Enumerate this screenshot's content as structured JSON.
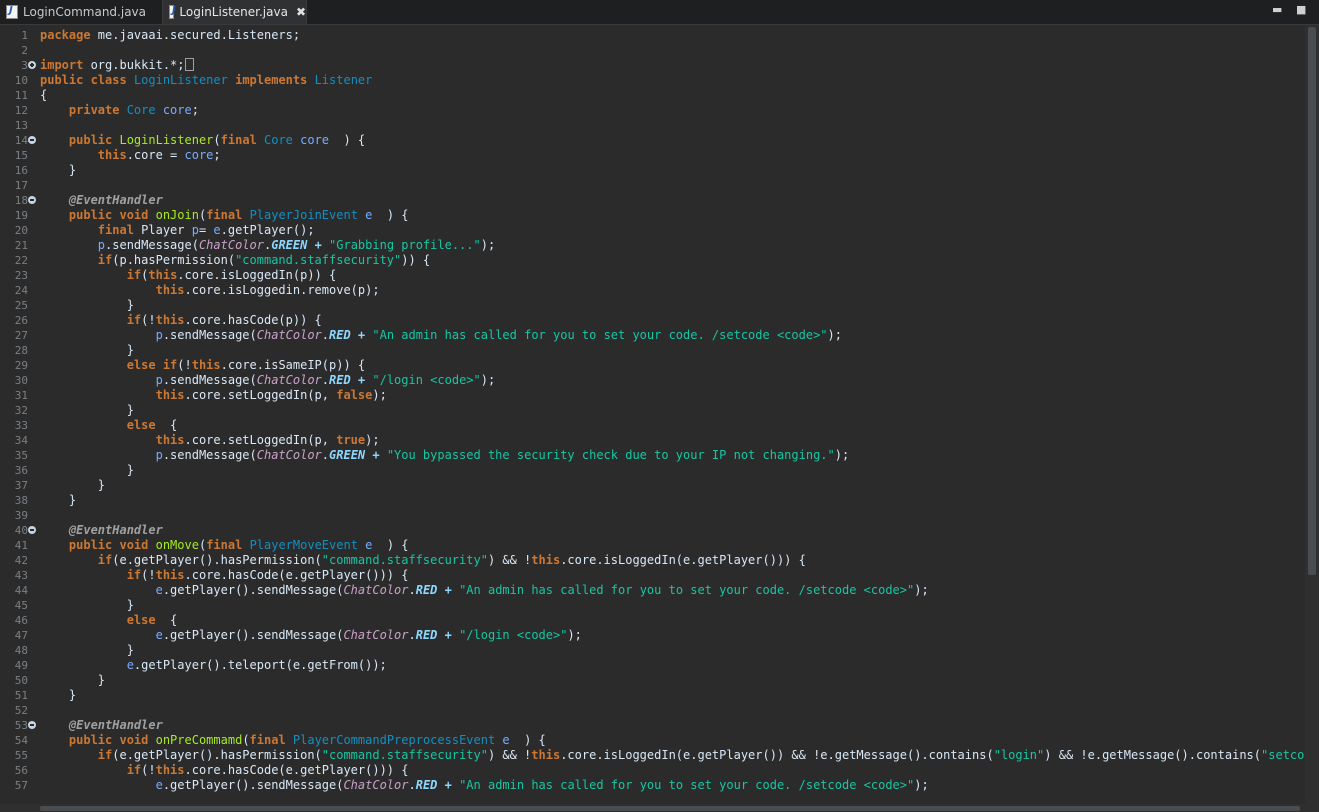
{
  "tabs": [
    {
      "label": "LoginCommand.java",
      "active": false
    },
    {
      "label": "LoginListener.java",
      "active": true
    }
  ],
  "window": {
    "close_tab_glyph": "✖",
    "minimize_glyph": "▬",
    "maximize_glyph": "■"
  },
  "editor": {
    "lines": [
      {
        "n": "1",
        "fold": "",
        "t": [
          [
            "kw",
            "package"
          ],
          [
            "",
            "me.javaai.secured.Listeners;"
          ]
        ]
      },
      {
        "n": "2",
        "fold": "",
        "t": []
      },
      {
        "n": "3",
        "fold": "plus",
        "t": [
          [
            "kw",
            "import"
          ],
          [
            "",
            "org.bukkit.*;"
          ]
        ]
      },
      {
        "n": "10",
        "fold": "",
        "t": [
          [
            "kw",
            "public"
          ],
          [
            "kw",
            "class"
          ],
          [
            "ty",
            "LoginListener"
          ],
          [
            "kw",
            "implements"
          ],
          [
            "ty",
            "Listener"
          ]
        ]
      },
      {
        "n": "11",
        "fold": "",
        "t": [
          [
            "",
            "{"
          ]
        ]
      },
      {
        "n": "12",
        "fold": "",
        "t": [
          [
            "kw",
            "    private"
          ],
          [
            "ty",
            "Core"
          ],
          [
            "va",
            "core"
          ],
          [
            "",
            ";"
          ]
        ]
      },
      {
        "n": "13",
        "fold": "",
        "t": []
      },
      {
        "n": "14",
        "fold": "minus",
        "t": [
          [
            "kw",
            "    public"
          ],
          [
            "fn",
            "LoginListener"
          ],
          [
            "",
            "("
          ],
          [
            "kw",
            "final"
          ],
          [
            "ty",
            "Core"
          ],
          [
            "va",
            "core"
          ],
          [
            "",
            " ) {"
          ]
        ]
      },
      {
        "n": "15",
        "fold": "",
        "t": [
          [
            "kw",
            "        this"
          ],
          [
            "",
            ".core = "
          ],
          [
            "va",
            "core"
          ],
          [
            "",
            ";"
          ]
        ]
      },
      {
        "n": "16",
        "fold": "",
        "t": [
          [
            "",
            "    }"
          ]
        ]
      },
      {
        "n": "17",
        "fold": "",
        "t": []
      },
      {
        "n": "18",
        "fold": "minus",
        "t": [
          [
            "an",
            "    @EventHandler"
          ]
        ]
      },
      {
        "n": "19",
        "fold": "",
        "t": [
          [
            "kw",
            "    public"
          ],
          [
            "kw",
            "void"
          ],
          [
            "fn",
            "onJoin"
          ],
          [
            "",
            "("
          ],
          [
            "kw",
            "final"
          ],
          [
            "ty",
            "PlayerJoinEvent"
          ],
          [
            "va",
            "e"
          ],
          [
            "",
            " ) {"
          ]
        ]
      },
      {
        "n": "20",
        "fold": "",
        "t": [
          [
            "kw",
            "        final"
          ],
          [
            "",
            "Player "
          ],
          [
            "va",
            "p"
          ],
          [
            "",
            "= "
          ],
          [
            "va",
            "e"
          ],
          [
            "",
            ".getPlayer();"
          ]
        ]
      },
      {
        "n": "21",
        "fold": "",
        "t": [
          [
            "va",
            "        p"
          ],
          [
            "",
            ".sendMessage("
          ],
          [
            "cc",
            "ChatColor"
          ],
          [
            "",
            "."
          ],
          [
            "cn",
            "GREEN"
          ],
          [
            "",
            ""
          ],
          [
            "st",
            "\"Grabbing profile...\""
          ],
          [
            "",
            ");"
          ]
        ]
      },
      {
        "n": "22",
        "fold": "",
        "t": [
          [
            "kw",
            "        if"
          ],
          [
            "",
            "(p.hasPermission("
          ],
          [
            "st",
            "\"command.staffsecurity\""
          ],
          [
            "",
            ")) {"
          ]
        ]
      },
      {
        "n": "23",
        "fold": "",
        "t": [
          [
            "kw",
            "            if"
          ],
          [
            "",
            "("
          ],
          [
            "kw",
            "this"
          ],
          [
            "",
            ".core.isLoggedIn(p)) {"
          ]
        ]
      },
      {
        "n": "24",
        "fold": "",
        "t": [
          [
            "kw",
            "                this"
          ],
          [
            "",
            ".core.isLoggedin.remove(p);"
          ]
        ]
      },
      {
        "n": "25",
        "fold": "",
        "t": [
          [
            "",
            "            }"
          ]
        ]
      },
      {
        "n": "26",
        "fold": "",
        "t": [
          [
            "kw",
            "            if"
          ],
          [
            "",
            "(!"
          ],
          [
            "kw",
            "this"
          ],
          [
            "",
            ".core.hasCode(p)) {"
          ]
        ]
      },
      {
        "n": "27",
        "fold": "",
        "t": [
          [
            "va",
            "                p"
          ],
          [
            "",
            ".sendMessage("
          ],
          [
            "cc",
            "ChatColor"
          ],
          [
            "",
            "."
          ],
          [
            "cn",
            "RED"
          ],
          [
            "",
            ""
          ],
          [
            "st",
            "\"An admin has called for you to set your code. /setcode <code>\""
          ],
          [
            "",
            ");"
          ]
        ]
      },
      {
        "n": "28",
        "fold": "",
        "t": [
          [
            "",
            "            }"
          ]
        ]
      },
      {
        "n": "29",
        "fold": "",
        "t": [
          [
            "kw",
            "            else if"
          ],
          [
            "",
            "(!"
          ],
          [
            "kw",
            "this"
          ],
          [
            "",
            ".core.isSameIP(p)) {"
          ]
        ]
      },
      {
        "n": "30",
        "fold": "",
        "t": [
          [
            "va",
            "                p"
          ],
          [
            "",
            ".sendMessage("
          ],
          [
            "cc",
            "ChatColor"
          ],
          [
            "",
            "."
          ],
          [
            "cn",
            "RED"
          ],
          [
            "",
            ""
          ],
          [
            "st",
            "\"/login <code>\""
          ],
          [
            "",
            ");"
          ]
        ]
      },
      {
        "n": "31",
        "fold": "",
        "t": [
          [
            "kw",
            "                this"
          ],
          [
            "",
            ".core.setLoggedIn(p, "
          ],
          [
            "kw",
            "false"
          ],
          [
            "",
            ");"
          ]
        ]
      },
      {
        "n": "32",
        "fold": "",
        "t": [
          [
            "",
            "            }"
          ]
        ]
      },
      {
        "n": "33",
        "fold": "",
        "t": [
          [
            "kw",
            "            else"
          ],
          [
            "",
            " {"
          ]
        ]
      },
      {
        "n": "34",
        "fold": "",
        "t": [
          [
            "kw",
            "                this"
          ],
          [
            "",
            ".core.setLoggedIn(p, "
          ],
          [
            "kw",
            "true"
          ],
          [
            "",
            ");"
          ]
        ]
      },
      {
        "n": "35",
        "fold": "",
        "t": [
          [
            "va",
            "                p"
          ],
          [
            "",
            ".sendMessage("
          ],
          [
            "cc",
            "ChatColor"
          ],
          [
            "",
            "."
          ],
          [
            "cn",
            "GREEN"
          ],
          [
            "",
            ""
          ],
          [
            "st",
            "\"You bypassed the security check due to your IP not changing.\""
          ],
          [
            "",
            ");"
          ]
        ]
      },
      {
        "n": "36",
        "fold": "",
        "t": [
          [
            "",
            "            }"
          ]
        ]
      },
      {
        "n": "37",
        "fold": "",
        "t": [
          [
            "",
            "        }"
          ]
        ]
      },
      {
        "n": "38",
        "fold": "",
        "t": [
          [
            "",
            "    }"
          ]
        ]
      },
      {
        "n": "39",
        "fold": "",
        "t": []
      },
      {
        "n": "40",
        "fold": "minus",
        "t": [
          [
            "an",
            "    @EventHandler"
          ]
        ]
      },
      {
        "n": "41",
        "fold": "",
        "t": [
          [
            "kw",
            "    public"
          ],
          [
            "kw",
            "void"
          ],
          [
            "fn",
            "onMove"
          ],
          [
            "",
            "("
          ],
          [
            "kw",
            "final"
          ],
          [
            "ty",
            "PlayerMoveEvent"
          ],
          [
            "va",
            "e"
          ],
          [
            "",
            " ) {"
          ]
        ]
      },
      {
        "n": "42",
        "fold": "",
        "t": [
          [
            "kw",
            "        if"
          ],
          [
            "",
            "(e.getPlayer().hasPermission("
          ],
          [
            "st",
            "\"command.staffsecurity\""
          ],
          [
            "",
            ") && !"
          ],
          [
            "kw",
            "this"
          ],
          [
            "",
            ".core.isLoggedIn(e.getPlayer())) {"
          ]
        ]
      },
      {
        "n": "43",
        "fold": "",
        "t": [
          [
            "kw",
            "            if"
          ],
          [
            "",
            "(!"
          ],
          [
            "kw",
            "this"
          ],
          [
            "",
            ".core.hasCode(e.getPlayer())) {"
          ]
        ]
      },
      {
        "n": "44",
        "fold": "",
        "t": [
          [
            "va",
            "                e"
          ],
          [
            "",
            ".getPlayer().sendMessage("
          ],
          [
            "cc",
            "ChatColor"
          ],
          [
            "",
            "."
          ],
          [
            "cn",
            "RED"
          ],
          [
            "",
            ""
          ],
          [
            "st",
            "\"An admin has called for you to set your code. /setcode <code>\""
          ],
          [
            "",
            ");"
          ]
        ]
      },
      {
        "n": "45",
        "fold": "",
        "t": [
          [
            "",
            "            }"
          ]
        ]
      },
      {
        "n": "46",
        "fold": "",
        "t": [
          [
            "kw",
            "            else"
          ],
          [
            "",
            " {"
          ]
        ]
      },
      {
        "n": "47",
        "fold": "",
        "t": [
          [
            "va",
            "                e"
          ],
          [
            "",
            ".getPlayer().sendMessage("
          ],
          [
            "cc",
            "ChatColor"
          ],
          [
            "",
            "."
          ],
          [
            "cn",
            "RED"
          ],
          [
            "",
            ""
          ],
          [
            "st",
            "\"/login <code>\""
          ],
          [
            "",
            ");"
          ]
        ]
      },
      {
        "n": "48",
        "fold": "",
        "t": [
          [
            "",
            "            }"
          ]
        ]
      },
      {
        "n": "49",
        "fold": "",
        "t": [
          [
            "va",
            "            e"
          ],
          [
            "",
            ".getPlayer().teleport(e.getFrom());"
          ]
        ]
      },
      {
        "n": "50",
        "fold": "",
        "t": [
          [
            "",
            "        }"
          ]
        ]
      },
      {
        "n": "51",
        "fold": "",
        "t": [
          [
            "",
            "    }"
          ]
        ]
      },
      {
        "n": "52",
        "fold": "",
        "t": []
      },
      {
        "n": "53",
        "fold": "minus",
        "t": [
          [
            "an",
            "    @EventHandler"
          ]
        ]
      },
      {
        "n": "54",
        "fold": "",
        "t": [
          [
            "kw",
            "    public"
          ],
          [
            "kw",
            "void"
          ],
          [
            "fn",
            "onPreCommamd"
          ],
          [
            "",
            "("
          ],
          [
            "kw",
            "final"
          ],
          [
            "ty",
            "PlayerCommandPreprocessEvent"
          ],
          [
            "va",
            "e"
          ],
          [
            "",
            " ) {"
          ]
        ]
      },
      {
        "n": "55",
        "fold": "",
        "t": [
          [
            "kw",
            "        if"
          ],
          [
            "",
            "(e.getPlayer().hasPermission("
          ],
          [
            "st",
            "\"command.staffsecurity\""
          ],
          [
            "",
            ") && !"
          ],
          [
            "kw",
            "this"
          ],
          [
            "",
            ".core.isLoggedIn(e.getPlayer()) && !e.getMessage().contains("
          ],
          [
            "st",
            "\"login\""
          ],
          [
            "",
            ") && !e.getMessage().contains("
          ],
          [
            "st",
            "\"setcode\""
          ],
          [
            "",
            ")"
          ]
        ]
      },
      {
        "n": "56",
        "fold": "",
        "t": [
          [
            "kw",
            "            if"
          ],
          [
            "",
            "(!"
          ],
          [
            "kw",
            "this"
          ],
          [
            "",
            ".core.hasCode(e.getPlayer())) {"
          ]
        ]
      },
      {
        "n": "57",
        "fold": "",
        "t": [
          [
            "va",
            "                e"
          ],
          [
            "",
            ".getPlayer().sendMessage("
          ],
          [
            "cc",
            "ChatColor"
          ],
          [
            "",
            "."
          ],
          [
            "cn",
            "RED"
          ],
          [
            "",
            ""
          ],
          [
            "st",
            "\"An admin has called for you to set your code. /setcode <code>\""
          ],
          [
            "",
            ");"
          ]
        ]
      }
    ]
  }
}
